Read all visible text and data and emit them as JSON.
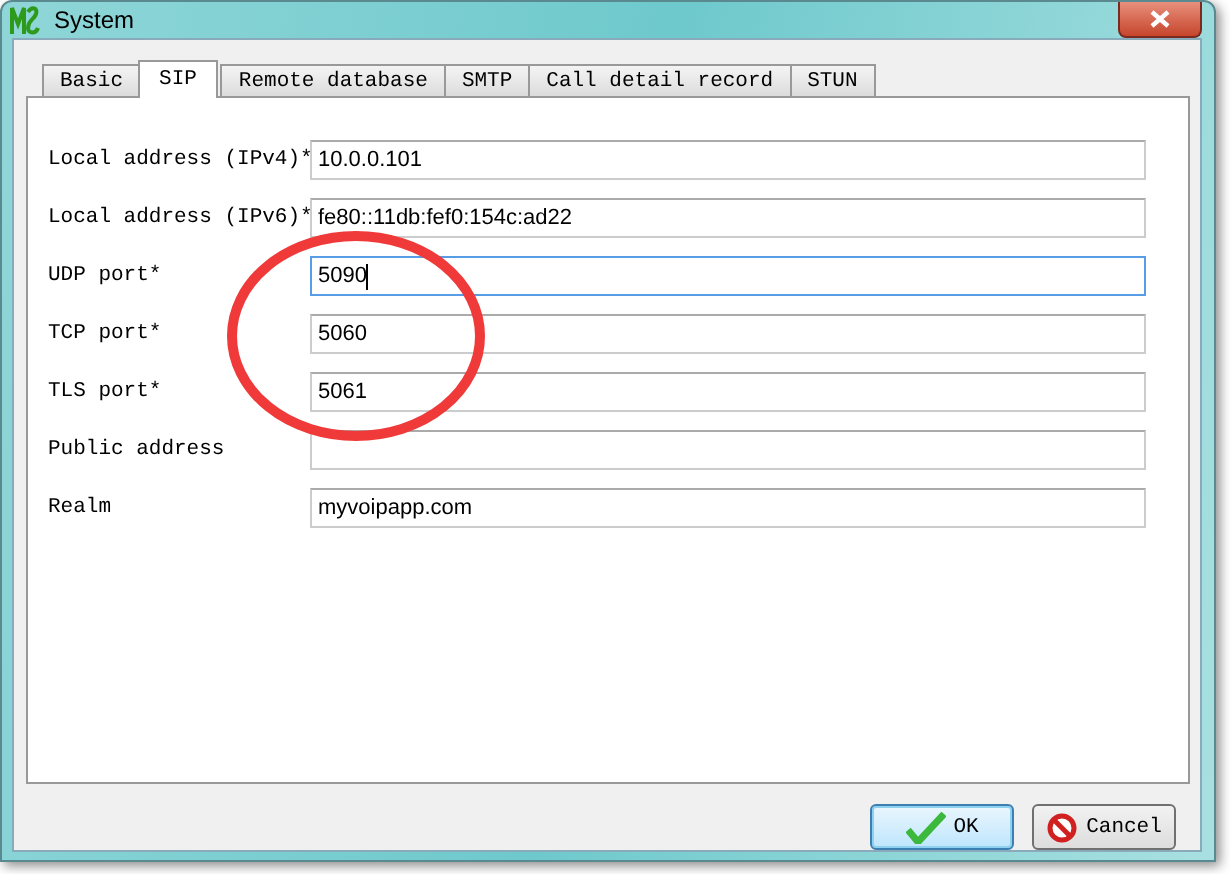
{
  "window": {
    "title": "System"
  },
  "tabs": [
    {
      "label": "Basic",
      "selected": false
    },
    {
      "label": "SIP",
      "selected": true
    },
    {
      "label": "Remote database",
      "selected": false
    },
    {
      "label": "SMTP",
      "selected": false
    },
    {
      "label": "Call detail record",
      "selected": false
    },
    {
      "label": "STUN",
      "selected": false
    }
  ],
  "fields": [
    {
      "label": "Local address (IPv4)*",
      "value": "10.0.0.101",
      "focused": false
    },
    {
      "label": "Local address (IPv6)*",
      "value": "fe80::11db:fef0:154c:ad22",
      "focused": false
    },
    {
      "label": "UDP port*",
      "value": "5090",
      "focused": true
    },
    {
      "label": "TCP port*",
      "value": "5060",
      "focused": false
    },
    {
      "label": "TLS port*",
      "value": "5061",
      "focused": false
    },
    {
      "label": "Public address",
      "focused": false
    },
    {
      "label": "Realm",
      "value": "myvoipapp.com",
      "focused": false
    }
  ],
  "buttons": [
    {
      "label": "OK",
      "kind": "ok",
      "default": true
    },
    {
      "label": "Cancel",
      "kind": "cancel",
      "default": false
    }
  ]
}
